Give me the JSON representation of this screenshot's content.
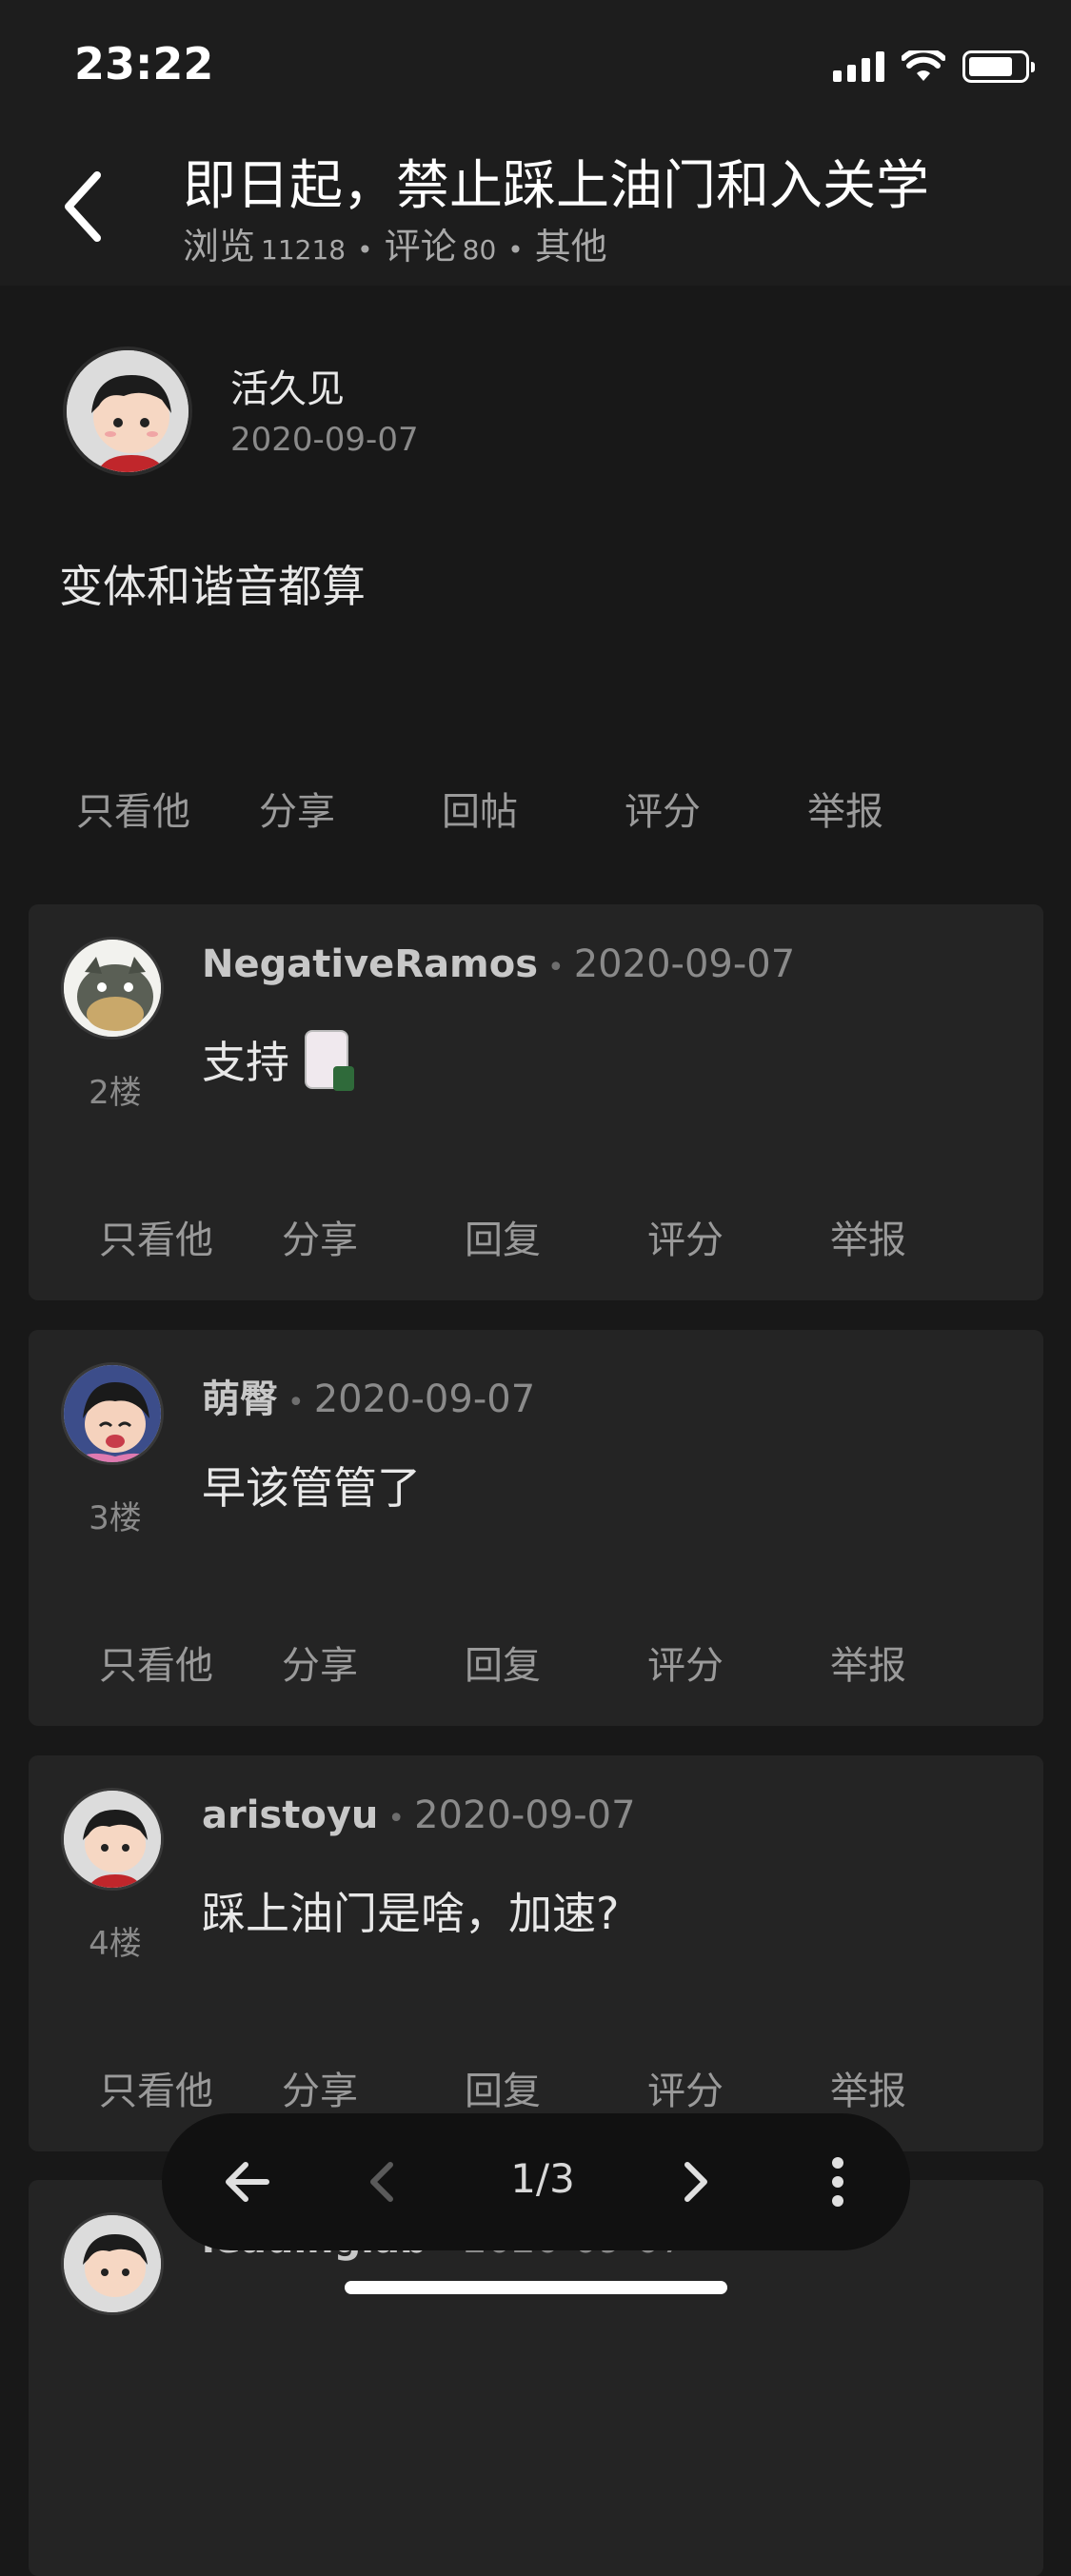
{
  "status_bar": {
    "time": "23:22"
  },
  "header": {
    "title": "即日起，禁止踩上油门和入关学",
    "views_label": "浏览",
    "views_count": "11218",
    "comments_label": "评论",
    "comments_count": "80",
    "category": "其他"
  },
  "op": {
    "author": "活久见",
    "date": "2020-09-07",
    "body": "变体和谐音都算",
    "actions": [
      "只看他",
      "分享",
      "回帖",
      "评分",
      "举报"
    ]
  },
  "replies": [
    {
      "name": "NegativeRamos",
      "date": "2020-09-07",
      "floor": "2楼",
      "body": "支持",
      "has_sticker": true
    },
    {
      "name": "萌臀",
      "date": "2020-09-07",
      "floor": "3楼",
      "body": "早该管管了",
      "has_sticker": false
    },
    {
      "name": "aristoyu",
      "date": "2020-09-07",
      "floor": "4楼",
      "body": "踩上油门是啥，加速?",
      "has_sticker": false
    },
    {
      "name": "leadinglab",
      "date": "2020-09-07",
      "floor": "",
      "body": "",
      "has_sticker": false
    }
  ],
  "reply_actions": [
    "只看他",
    "分享",
    "回复",
    "评分",
    "举报"
  ],
  "pager": {
    "label": "1/3"
  },
  "icons": {
    "back": "chevron-left-icon",
    "prev_page": "arrow-left-icon",
    "prev": "chevron-left-icon",
    "next": "chevron-right-icon",
    "more": "more-vertical-icon"
  },
  "colors": {
    "background": "#181818",
    "card": "#242424",
    "pager": "#111111"
  }
}
